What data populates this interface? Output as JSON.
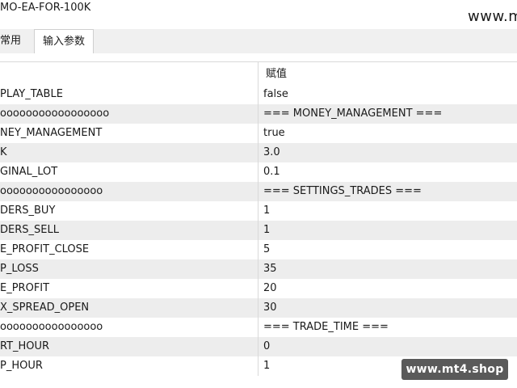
{
  "window": {
    "title": "MO-EA-FOR-100K",
    "watermark_top": "www.mt"
  },
  "tabs": [
    {
      "label": "常用",
      "active": false
    },
    {
      "label": "输入参数",
      "active": true
    }
  ],
  "table": {
    "columns": [
      "",
      "赋值"
    ],
    "rows": [
      {
        "name": "PLAY_TABLE",
        "value": "false"
      },
      {
        "name": "ooooooooooooooooo",
        "value": "=== MONEY_MANAGEMENT ==="
      },
      {
        "name": "NEY_MANAGEMENT",
        "value": "true"
      },
      {
        "name": "K",
        "value": "3.0"
      },
      {
        "name": "GINAL_LOT",
        "value": "0.1"
      },
      {
        "name": "oooooooooooooooo",
        "value": "=== SETTINGS_TRADES ==="
      },
      {
        "name": "DERS_BUY",
        "value": "1"
      },
      {
        "name": "DERS_SELL",
        "value": "1"
      },
      {
        "name": "E_PROFIT_CLOSE",
        "value": "5"
      },
      {
        "name": "P_LOSS",
        "value": "35"
      },
      {
        "name": "E_PROFIT",
        "value": "20"
      },
      {
        "name": "X_SPREAD_OPEN",
        "value": "30"
      },
      {
        "name": "oooooooooooooooo",
        "value": "=== TRADE_TIME ==="
      },
      {
        "name": "RT_HOUR",
        "value": "0"
      },
      {
        "name": "P_HOUR",
        "value": "1"
      }
    ]
  },
  "watermark_badge": "www.mt4.shop"
}
